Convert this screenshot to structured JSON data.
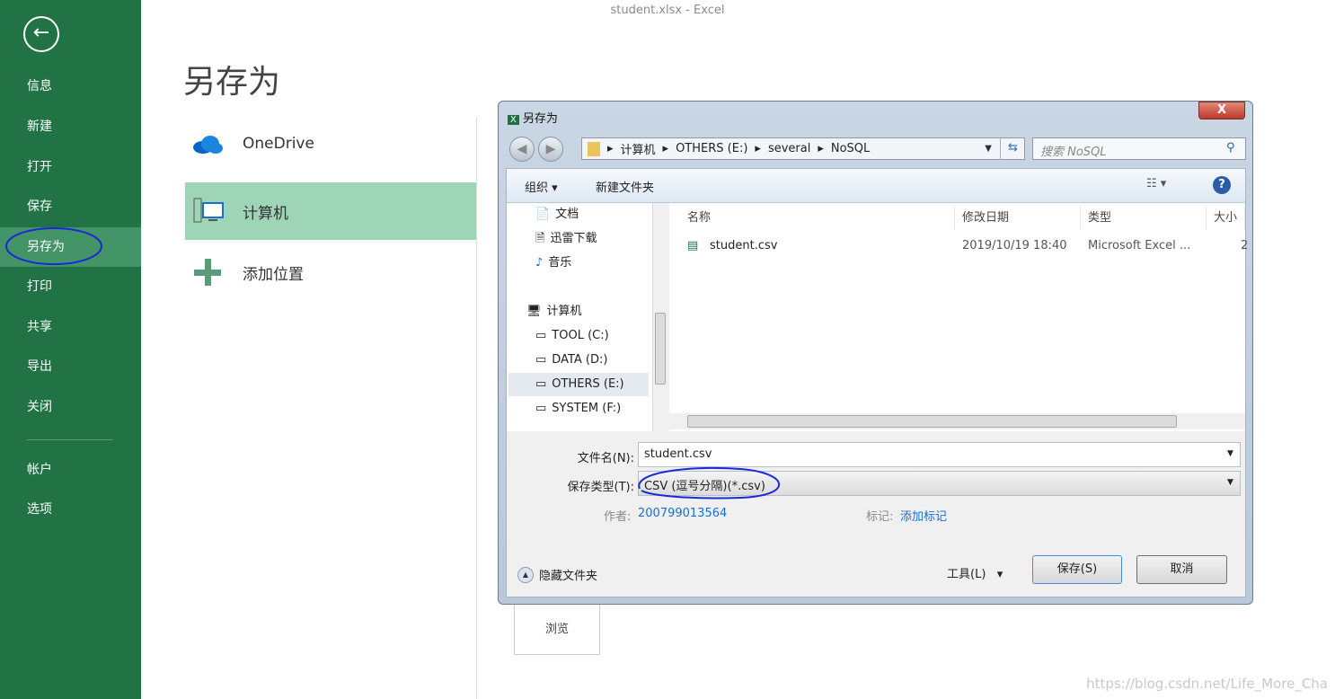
{
  "window_title": "student.xlsx - Excel",
  "sidebar": {
    "items": [
      {
        "label": "信息"
      },
      {
        "label": "新建"
      },
      {
        "label": "打开"
      },
      {
        "label": "保存"
      },
      {
        "label": "另存为"
      },
      {
        "label": "打印"
      },
      {
        "label": "共享"
      },
      {
        "label": "导出"
      },
      {
        "label": "关闭"
      },
      {
        "label": "帐户"
      },
      {
        "label": "选项"
      }
    ],
    "selected": "另存为"
  },
  "page_title": "另存为",
  "locations": [
    {
      "label": "OneDrive"
    },
    {
      "label": "计算机"
    },
    {
      "label": "添加位置"
    }
  ],
  "browse_label": "浏览",
  "dialog": {
    "title": "另存为",
    "close": "X",
    "breadcrumb": [
      "计算机",
      "OTHERS (E:)",
      "several",
      "NoSQL"
    ],
    "search_placeholder": "搜索 NoSQL",
    "toolbar": {
      "organize": "组织",
      "new_folder": "新建文件夹"
    },
    "tree": [
      {
        "label": "文档"
      },
      {
        "label": "迅雷下载"
      },
      {
        "label": "音乐"
      },
      {
        "label": "计算机"
      },
      {
        "label": "TOOL (C:)"
      },
      {
        "label": "DATA (D:)"
      },
      {
        "label": "OTHERS (E:)"
      },
      {
        "label": "SYSTEM (F:)"
      }
    ],
    "columns": [
      "名称",
      "修改日期",
      "类型",
      "大小"
    ],
    "files": [
      {
        "name": "student.csv",
        "modified": "2019/10/19 18:40",
        "type": "Microsoft Excel ...",
        "size": "2"
      }
    ],
    "filename_label": "文件名(N):",
    "filename": "student.csv",
    "filetype_label": "保存类型(T):",
    "filetype": "CSV (逗号分隔)(*.csv)",
    "author_label": "作者:",
    "author": "200799013564",
    "tags_label": "标记:",
    "tags": "添加标记",
    "hide_folders": "隐藏文件夹",
    "tools": "工具(L)",
    "save": "保存(S)",
    "cancel": "取消"
  },
  "watermark": "https://blog.csdn.net/Life_More_Cha"
}
